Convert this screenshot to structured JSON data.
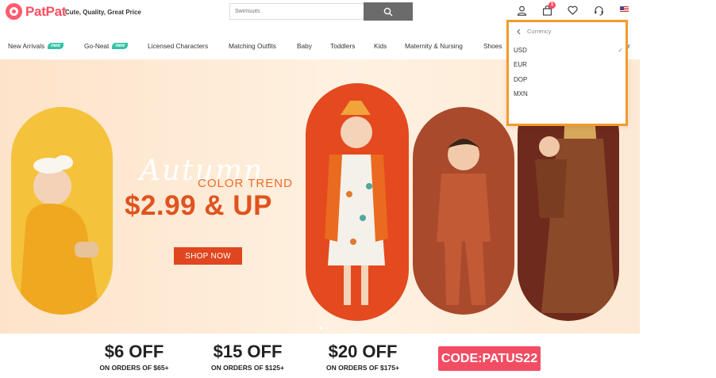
{
  "brand": {
    "name": "PatPat",
    "tagline": "Cute, Quality, Great Price",
    "accent": "#ff4f64"
  },
  "search": {
    "placeholder": "Swimsuits",
    "icon": "search-icon"
  },
  "header_icons": {
    "account": "user-icon",
    "cart": "bag-icon",
    "cart_count": "1",
    "wishlist": "heart-icon",
    "support": "headset-icon",
    "region": "us-flag-icon"
  },
  "nav": {
    "items": [
      {
        "label": "New Arrivals",
        "badge": "new"
      },
      {
        "label": "Go-Neat",
        "badge": "new"
      },
      {
        "label": "Licensed Characters"
      },
      {
        "label": "Matching Outfits"
      },
      {
        "label": "Baby"
      },
      {
        "label": "Toddlers"
      },
      {
        "label": "Kids"
      },
      {
        "label": "Maternity & Nursing"
      },
      {
        "label": "Shoes"
      }
    ],
    "overflow_tail": "r"
  },
  "banner": {
    "script_title": "Autumn",
    "subtitle": "COLOR TREND",
    "price_line": "$2.99 & UP",
    "cta": "SHOP NOW",
    "colors": {
      "background": "#fde3c9",
      "price": "#e0531f",
      "button": "#e0461f"
    }
  },
  "promos": [
    {
      "amount": "$6 OFF",
      "condition": "ON ORDERS OF $65+"
    },
    {
      "amount": "$15 OFF",
      "condition": "ON ORDERS OF $125+"
    },
    {
      "amount": "$20 OFF",
      "condition": "ON ORDERS OF $175+"
    }
  ],
  "promo_code": {
    "label": "CODE:",
    "code": "PATUS22",
    "color": "#f24d63"
  },
  "currency_menu": {
    "title": "Currency",
    "back_icon": "chevron-left-icon",
    "options": [
      {
        "code": "USD",
        "selected": true
      },
      {
        "code": "EUR",
        "selected": false
      },
      {
        "code": "DOP",
        "selected": false
      },
      {
        "code": "MXN",
        "selected": false
      }
    ],
    "check_icon": "checkmark-icon",
    "highlight_color": "#f39a2c"
  }
}
